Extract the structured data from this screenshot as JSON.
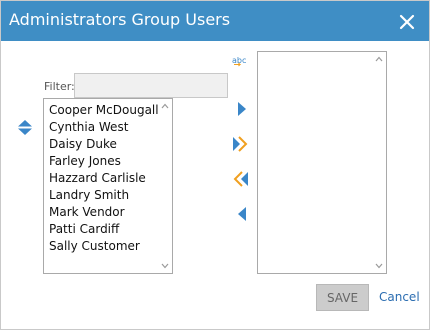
{
  "dialog": {
    "title": "Administrators Group Users",
    "close_icon": "close-icon"
  },
  "filter": {
    "label": "Filter:",
    "value": "",
    "placeholder": ""
  },
  "available_users": [
    "Cooper McDougall",
    "Cynthia West",
    "Daisy Duke",
    "Farley Jones",
    "Hazzard Carlisle",
    "Landry Smith",
    "Mark Vendor",
    "Patti Cardiff",
    "Sally Customer"
  ],
  "selected_users": [],
  "controls": {
    "sort_icon": "sort-up-down-icon",
    "abc_icon": "abc-sort-icon",
    "add_icon": "arrow-right-icon",
    "add_all_icon": "double-arrow-right-icon",
    "remove_all_icon": "double-arrow-left-icon",
    "remove_icon": "arrow-left-icon"
  },
  "footer": {
    "save_label": "SAVE",
    "cancel_label": "Cancel"
  },
  "colors": {
    "titlebar": "#3f8ec5",
    "arrow_blue": "#3a86c8",
    "arrow_orange": "#f0a020",
    "link": "#2b6db1"
  }
}
